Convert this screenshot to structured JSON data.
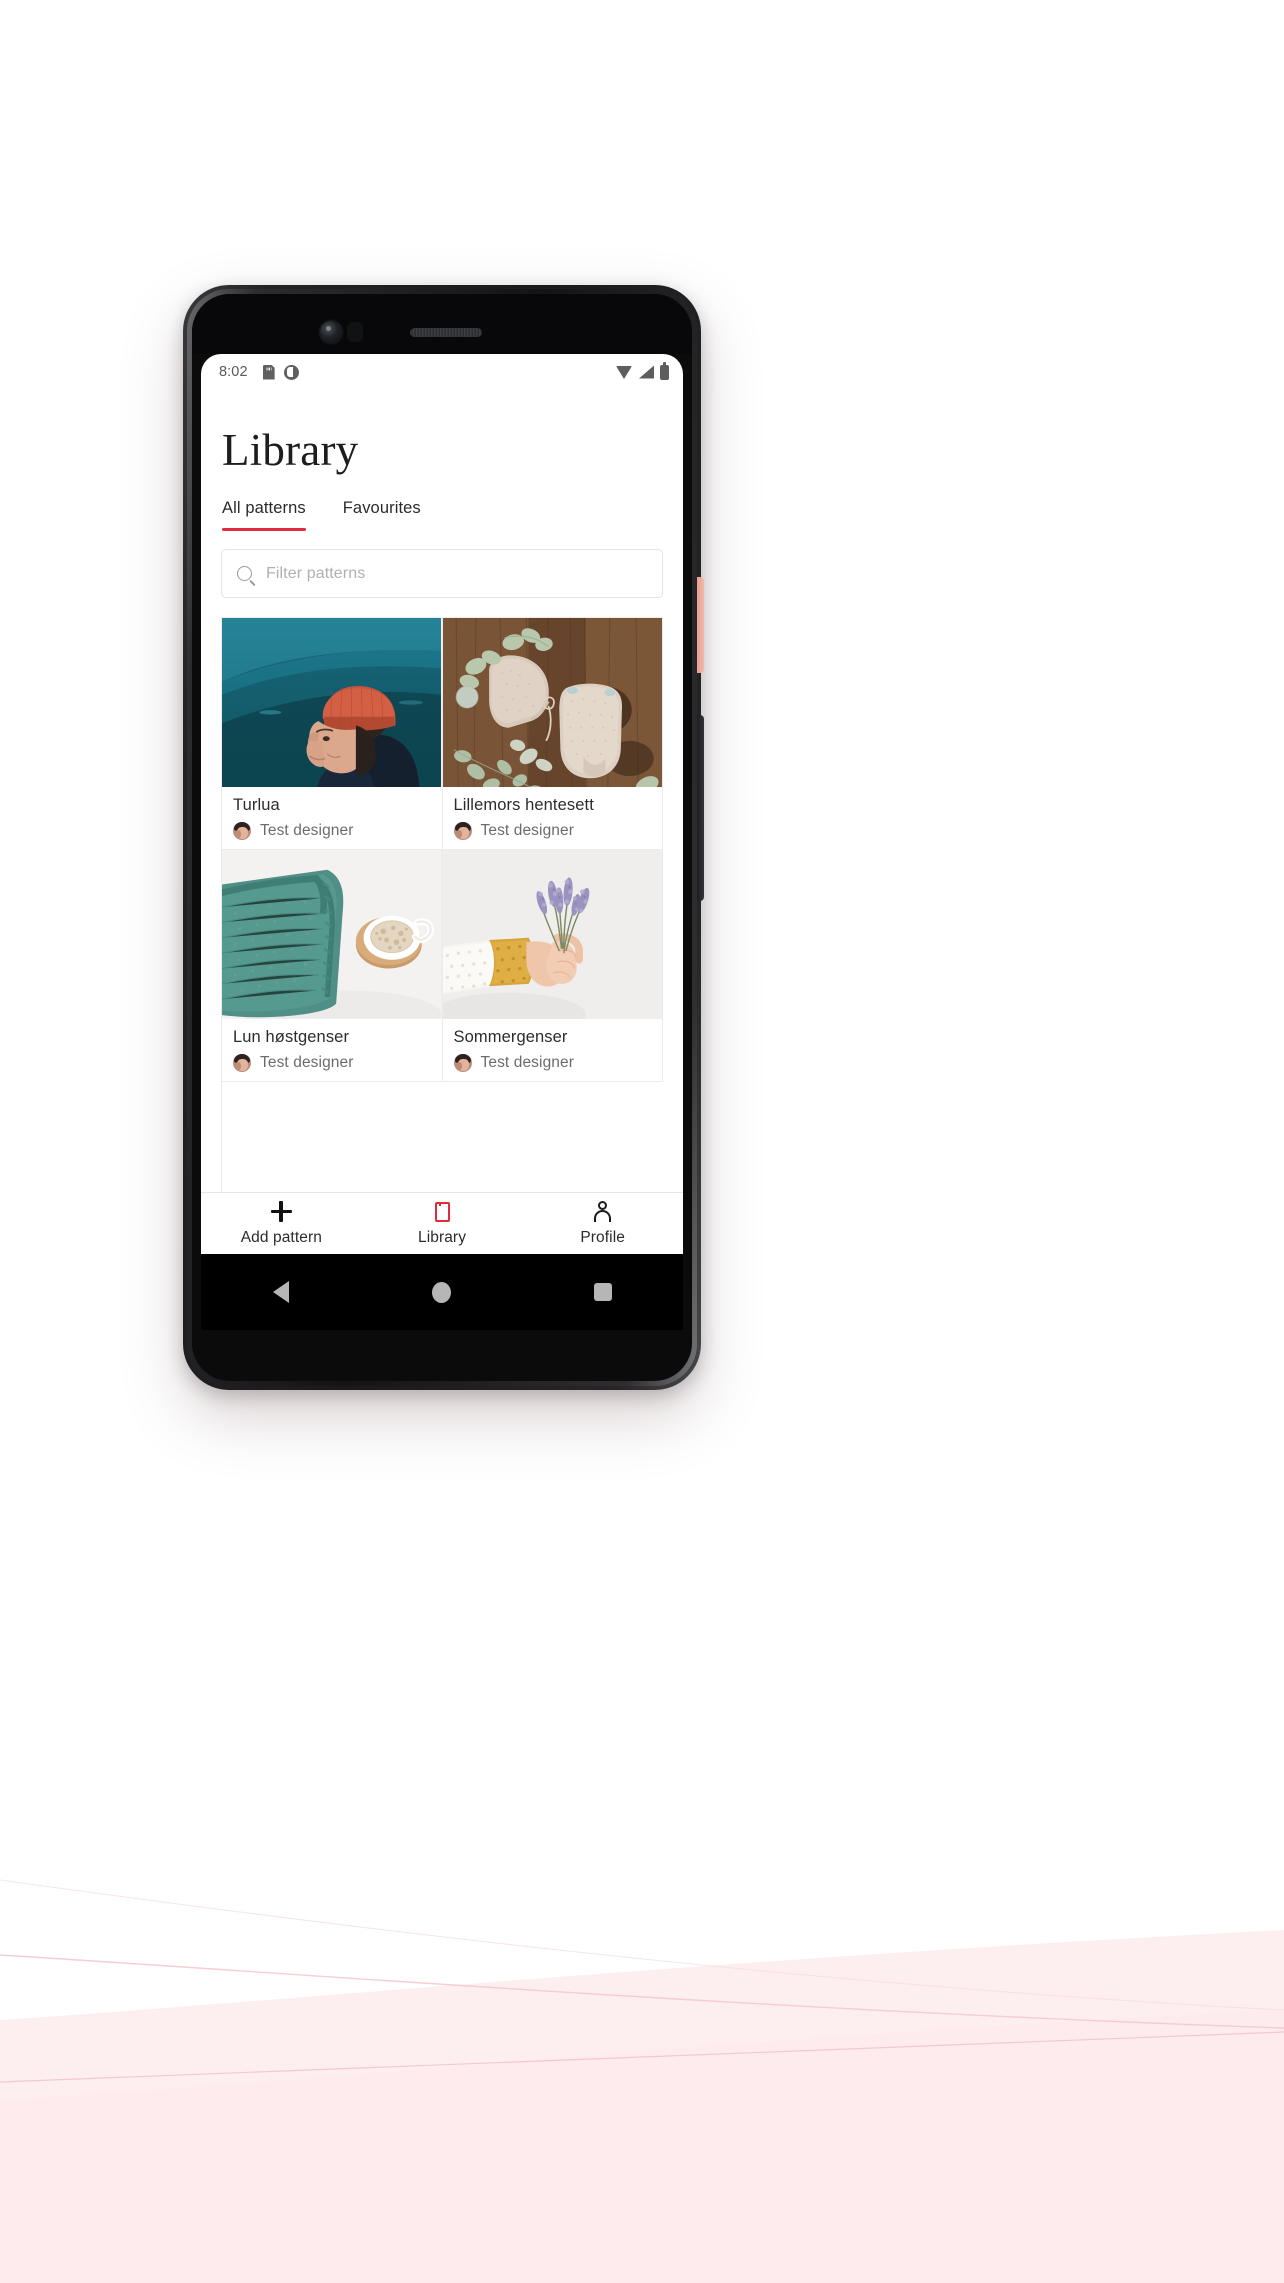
{
  "statusbar": {
    "time": "8:02",
    "left_icons": [
      "sd-card-icon",
      "screenshot-icon"
    ],
    "right_icons": [
      "wifi-icon",
      "cellular-signal-icon",
      "battery-icon"
    ]
  },
  "header": {
    "title": "Library"
  },
  "tabs": [
    {
      "label": "All patterns",
      "active": true
    },
    {
      "label": "Favourites",
      "active": false
    }
  ],
  "search": {
    "placeholder": "Filter patterns",
    "value": "",
    "icon": "search-icon"
  },
  "patterns": [
    {
      "title": "Turlua",
      "author": "Test designer",
      "image": "man-in-red-beanie-on-teal-mountain"
    },
    {
      "title": "Lillemors hentesett",
      "author": "Test designer",
      "image": "knitted-baby-bonnet-and-romper-on-wood"
    },
    {
      "title": "Lun høstgenser",
      "author": "Test designer",
      "image": "teal-knit-sweater-with-coffee-cup"
    },
    {
      "title": "Sommergenser",
      "author": "Test designer",
      "image": "arm-in-knit-sleeve-holding-lavender"
    }
  ],
  "bottom_nav": [
    {
      "label": "Add pattern",
      "icon": "plus-icon",
      "active": false
    },
    {
      "label": "Library",
      "icon": "book-icon",
      "active": true
    },
    {
      "label": "Profile",
      "icon": "person-icon",
      "active": false
    }
  ],
  "android_nav": {
    "back": "back-triangle-icon",
    "home": "home-circle-icon",
    "recents": "recents-square-icon"
  },
  "colors": {
    "accent": "#e12b3c",
    "text": "#2b2b2b",
    "muted": "#6c6c6c",
    "background": "#ffffff",
    "page_tint": "#fdeff0"
  }
}
